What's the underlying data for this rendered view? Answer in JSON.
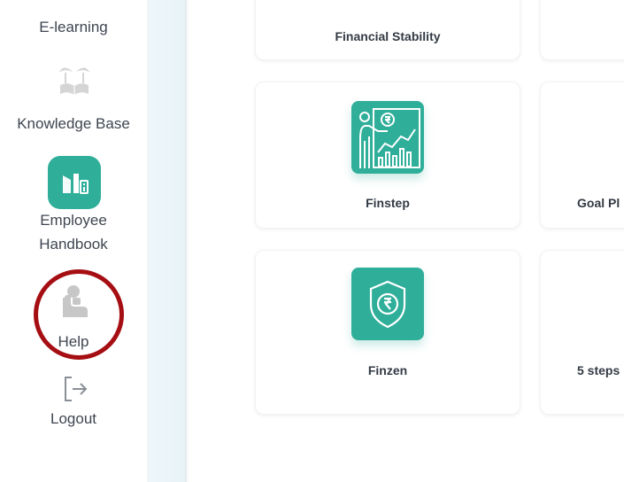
{
  "sidebar": {
    "items": [
      {
        "label": "E-learning",
        "icon": "e-learning-icon"
      },
      {
        "label": "Knowledge Base",
        "icon": "palm-book-icon"
      },
      {
        "label_line1": "Employee",
        "label_line2": "Handbook",
        "icon": "handbook-icon"
      },
      {
        "label": "Help",
        "icon": "help-person-icon"
      },
      {
        "label": "Logout",
        "icon": "logout-icon"
      }
    ]
  },
  "cards": [
    {
      "label": "Financial Stability"
    },
    {
      "label": "Finstep",
      "icon": "finstep-presentation-icon"
    },
    {
      "label": "Goal Pl",
      "icon": ""
    },
    {
      "label": "Finzen",
      "icon": "rupee-shield-icon"
    },
    {
      "label": "5 steps",
      "icon": ""
    }
  ],
  "colors": {
    "accent": "#2fae9a",
    "highlight_circle": "#a50e12",
    "sidebar_text": "#3f4550"
  }
}
